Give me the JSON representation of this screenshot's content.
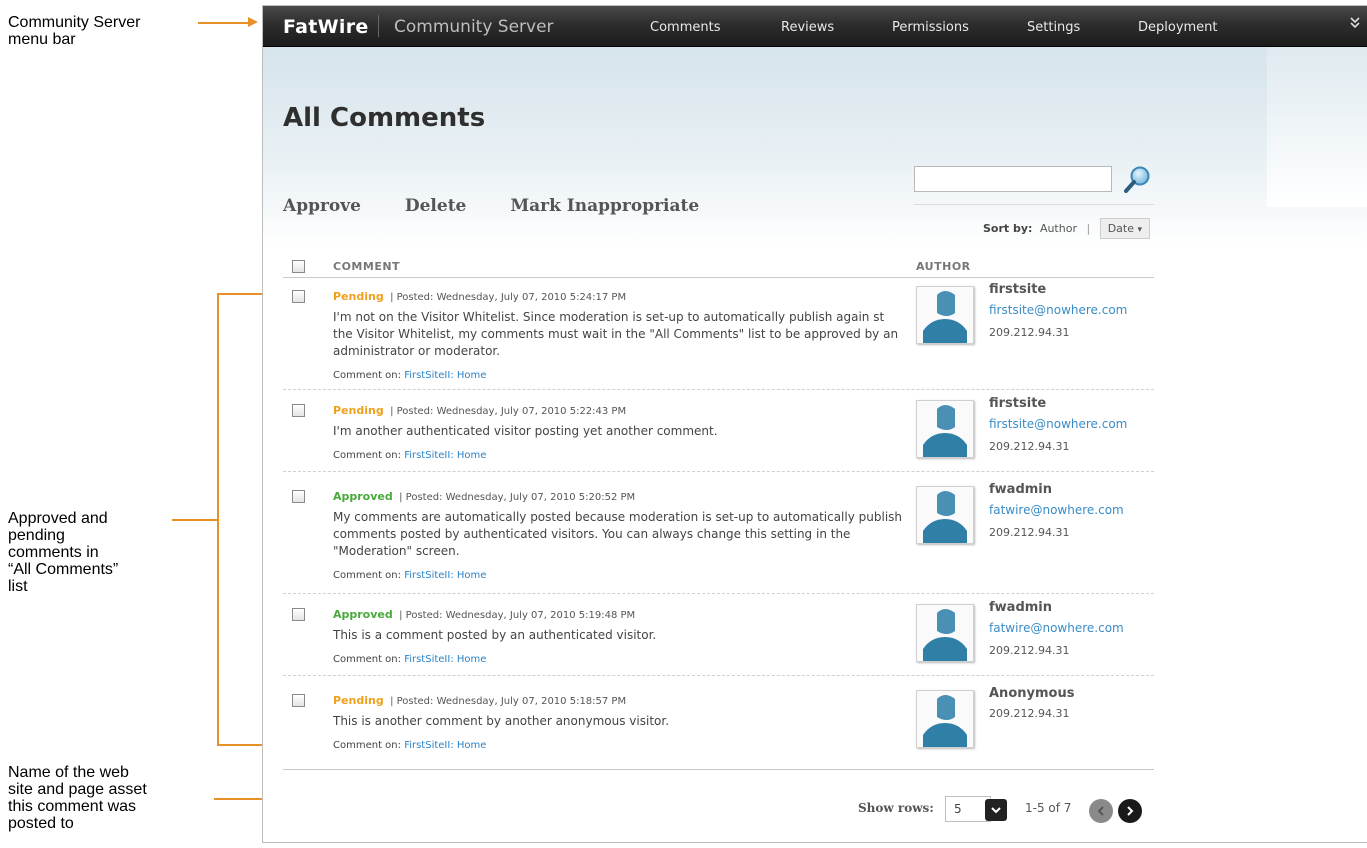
{
  "callouts": {
    "menubar": [
      "Community Server",
      "menu bar"
    ],
    "comments": [
      "Approved and",
      "pending",
      "comments in",
      "“All Comments”",
      "list"
    ],
    "site": [
      "Name of the web",
      "site and page asset",
      "this comment was",
      "posted to"
    ]
  },
  "menubar": {
    "brand": "FatWire",
    "product": "Community Server",
    "items": [
      "Comments",
      "Reviews",
      "Permissions",
      "Settings",
      "Deployment"
    ],
    "collapse_icon": "collapse-chevron-icon"
  },
  "page": {
    "title": "All Comments",
    "actions": [
      "Approve",
      "Delete",
      "Mark Inappropriate"
    ],
    "search": {
      "value": "",
      "icon": "search-icon"
    },
    "sort": {
      "label": "Sort by:",
      "options": [
        "Author",
        "Date"
      ],
      "selected": "Date",
      "arrow": "▾"
    }
  },
  "table": {
    "columns": {
      "comment": "COMMENT",
      "author": "AUTHOR"
    },
    "comment_on_label": "Comment on:",
    "rows": [
      {
        "status": "Pending",
        "posted": "| Posted: Wednesday, July 07, 2010 5:24:17 PM",
        "text": "I'm not on the Visitor Whitelist. Since moderation is set-up to automatically publish again st the Visitor Whitelist, my comments must wait in the \"All Comments\" list to be approved by an administrator or moderator.",
        "comment_on": "FirstSiteII: Home",
        "author": "firstsite",
        "email": "firstsite@nowhere.com",
        "ip": "209.212.94.31"
      },
      {
        "status": "Pending",
        "posted": "| Posted: Wednesday, July 07, 2010 5:22:43 PM",
        "text": "I'm another authenticated visitor posting yet another comment.",
        "comment_on": "FirstSiteII: Home",
        "author": "firstsite",
        "email": "firstsite@nowhere.com",
        "ip": "209.212.94.31"
      },
      {
        "status": "Approved",
        "posted": "| Posted: Wednesday, July 07, 2010 5:20:52 PM",
        "text": "My comments are automatically posted because moderation is set-up to automatically publish comments posted by authenticated visitors. You can always change this setting in the \"Moderation\" screen.",
        "comment_on": "FirstSiteII: Home",
        "author": "fwadmin",
        "email": "fatwire@nowhere.com",
        "ip": "209.212.94.31"
      },
      {
        "status": "Approved",
        "posted": "| Posted: Wednesday, July 07, 2010 5:19:48 PM",
        "text": "This is a comment posted by an authenticated visitor.",
        "comment_on": "FirstSiteII: Home",
        "author": "fwadmin",
        "email": "fatwire@nowhere.com",
        "ip": "209.212.94.31"
      },
      {
        "status": "Pending",
        "posted": "| Posted: Wednesday, July 07, 2010 5:18:57 PM",
        "text": "This is another comment by another anonymous visitor.",
        "comment_on": "FirstSiteII: Home",
        "author": "Anonymous",
        "email": "",
        "ip": "209.212.94.31"
      }
    ]
  },
  "pager": {
    "show_rows_label": "Show rows:",
    "rows_value": "5",
    "range": "1-5 of 7",
    "prev_icon": "prev-page-icon",
    "next_icon": "next-page-icon"
  },
  "colors": {
    "callout": "#e8902a",
    "pending": "#f0a11c",
    "approved": "#4aa93c",
    "link": "#2a83c6"
  }
}
